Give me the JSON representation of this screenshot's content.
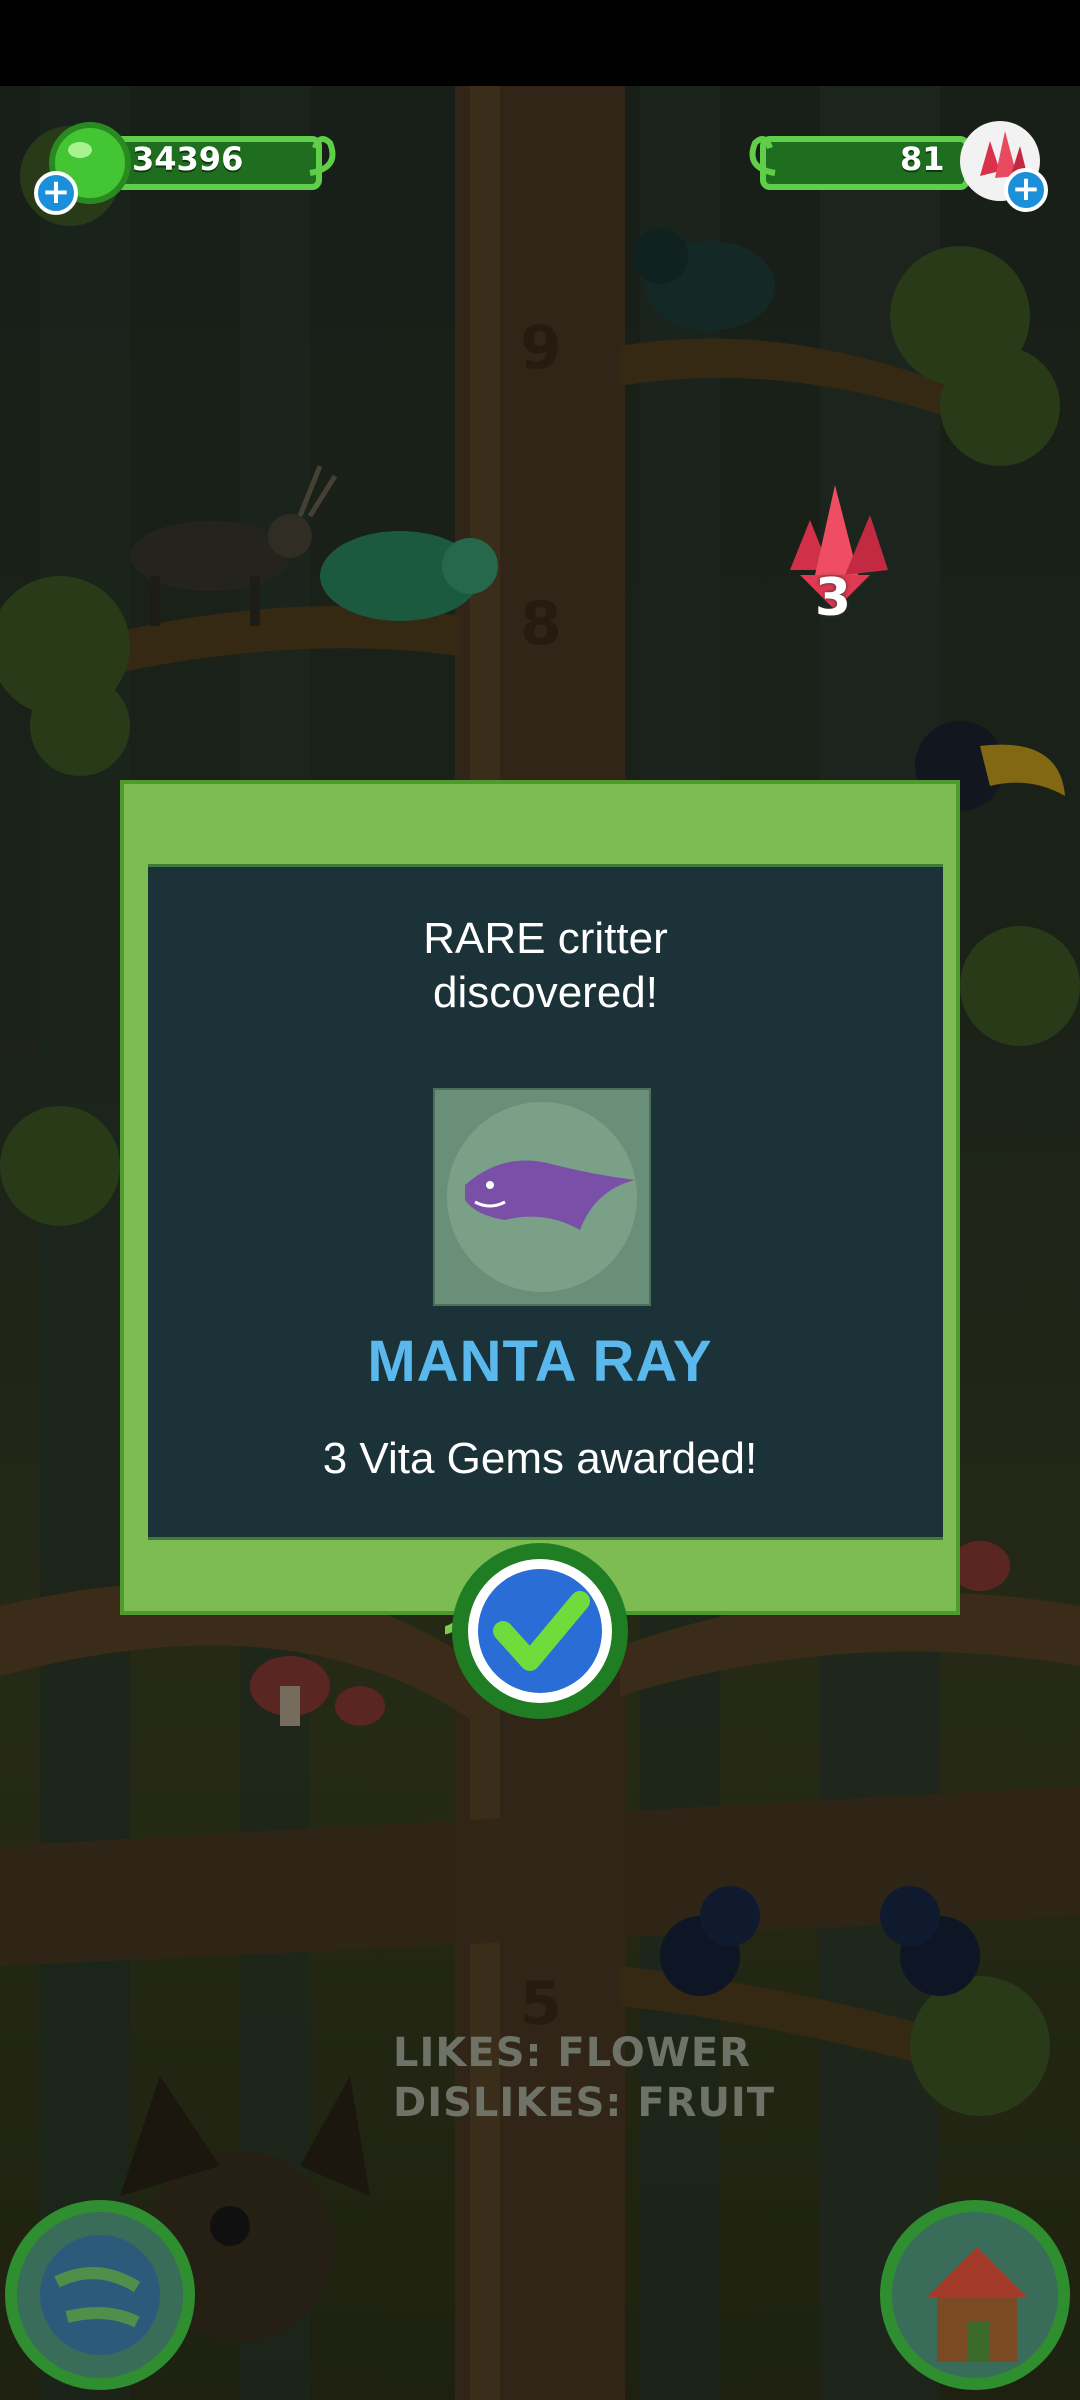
{
  "hud": {
    "currency": "34396",
    "gems": "81"
  },
  "reward_popup": {
    "gem_count": "3"
  },
  "dialog": {
    "title_line1": "RARE critter",
    "title_line2": "discovered!",
    "critter_name": "MANTA RAY",
    "award_text": "3 Vita Gems awarded!",
    "critter_color": "#7a4fa8"
  },
  "tree": {
    "level_numbers": [
      "9",
      "8",
      "5"
    ],
    "likes_text": "LIKES: FLOWER",
    "dislikes_text": "DISLIKES: FRUIT"
  },
  "colors": {
    "dialog_frame": "#7cbc52",
    "dialog_panel": "#1b3238",
    "name_color": "#5bb8ec",
    "hud_green": "#1f6e1f"
  }
}
